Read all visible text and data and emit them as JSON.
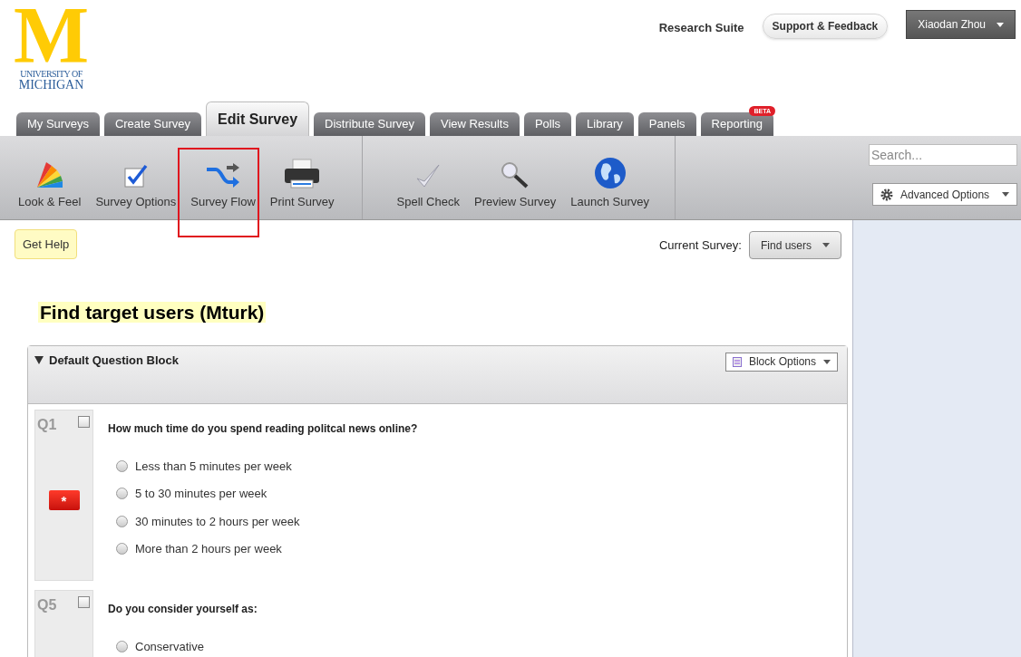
{
  "logo": {
    "mark": "M",
    "line1": "UNIVERSITY OF",
    "line2": "MICHIGAN"
  },
  "header": {
    "suite": "Research Suite",
    "support": "Support & Feedback",
    "user": "Xiaodan Zhou"
  },
  "tabs": [
    {
      "label": "My Surveys",
      "selected": false
    },
    {
      "label": "Create Survey",
      "selected": false
    },
    {
      "label": "Edit Survey",
      "selected": true
    },
    {
      "label": "Distribute Survey",
      "selected": false
    },
    {
      "label": "View Results",
      "selected": false
    },
    {
      "label": "Polls",
      "selected": false
    },
    {
      "label": "Library",
      "selected": false
    },
    {
      "label": "Panels",
      "selected": false
    },
    {
      "label": "Reporting",
      "selected": false,
      "badge": "BETA"
    }
  ],
  "toolbar": {
    "groups": [
      [
        {
          "label": "Look & Feel",
          "kind": "palette",
          "highlighted": false
        },
        {
          "label": "Survey Options",
          "kind": "checkbox",
          "highlighted": false
        },
        {
          "label": "Survey Flow",
          "kind": "flow",
          "highlighted": true
        },
        {
          "label": "Print Survey",
          "kind": "printer",
          "highlighted": false
        }
      ],
      [
        {
          "label": "Spell Check",
          "kind": "check",
          "highlighted": false
        },
        {
          "label": "Preview Survey",
          "kind": "magnifier",
          "highlighted": false
        },
        {
          "label": "Launch Survey",
          "kind": "globe",
          "highlighted": false
        }
      ]
    ],
    "search": {
      "placeholder": "Search..."
    },
    "advanced": "Advanced Options"
  },
  "help": "Get Help",
  "current_survey": {
    "label": "Current Survey:",
    "value": "Find users"
  },
  "survey_title": "Find target users (Mturk)",
  "block": {
    "title": "Default Question Block",
    "expanded": true,
    "options": "Block Options",
    "questions": [
      {
        "number": "Q1",
        "checked": false,
        "required": true,
        "required_mark": "*",
        "text": "How much time do you spend reading politcal news online?",
        "choices": [
          {
            "label": "Less than 5 minutes per week",
            "selected": false
          },
          {
            "label": "5 to 30 minutes per week",
            "selected": false
          },
          {
            "label": "30 minutes to 2 hours per week",
            "selected": false
          },
          {
            "label": "More than 2 hours per week",
            "selected": false
          }
        ]
      },
      {
        "number": "Q5",
        "checked": false,
        "required": false,
        "text": "Do you consider yourself as:",
        "choices": [
          {
            "label": "Conservative",
            "selected": false
          }
        ]
      }
    ]
  }
}
